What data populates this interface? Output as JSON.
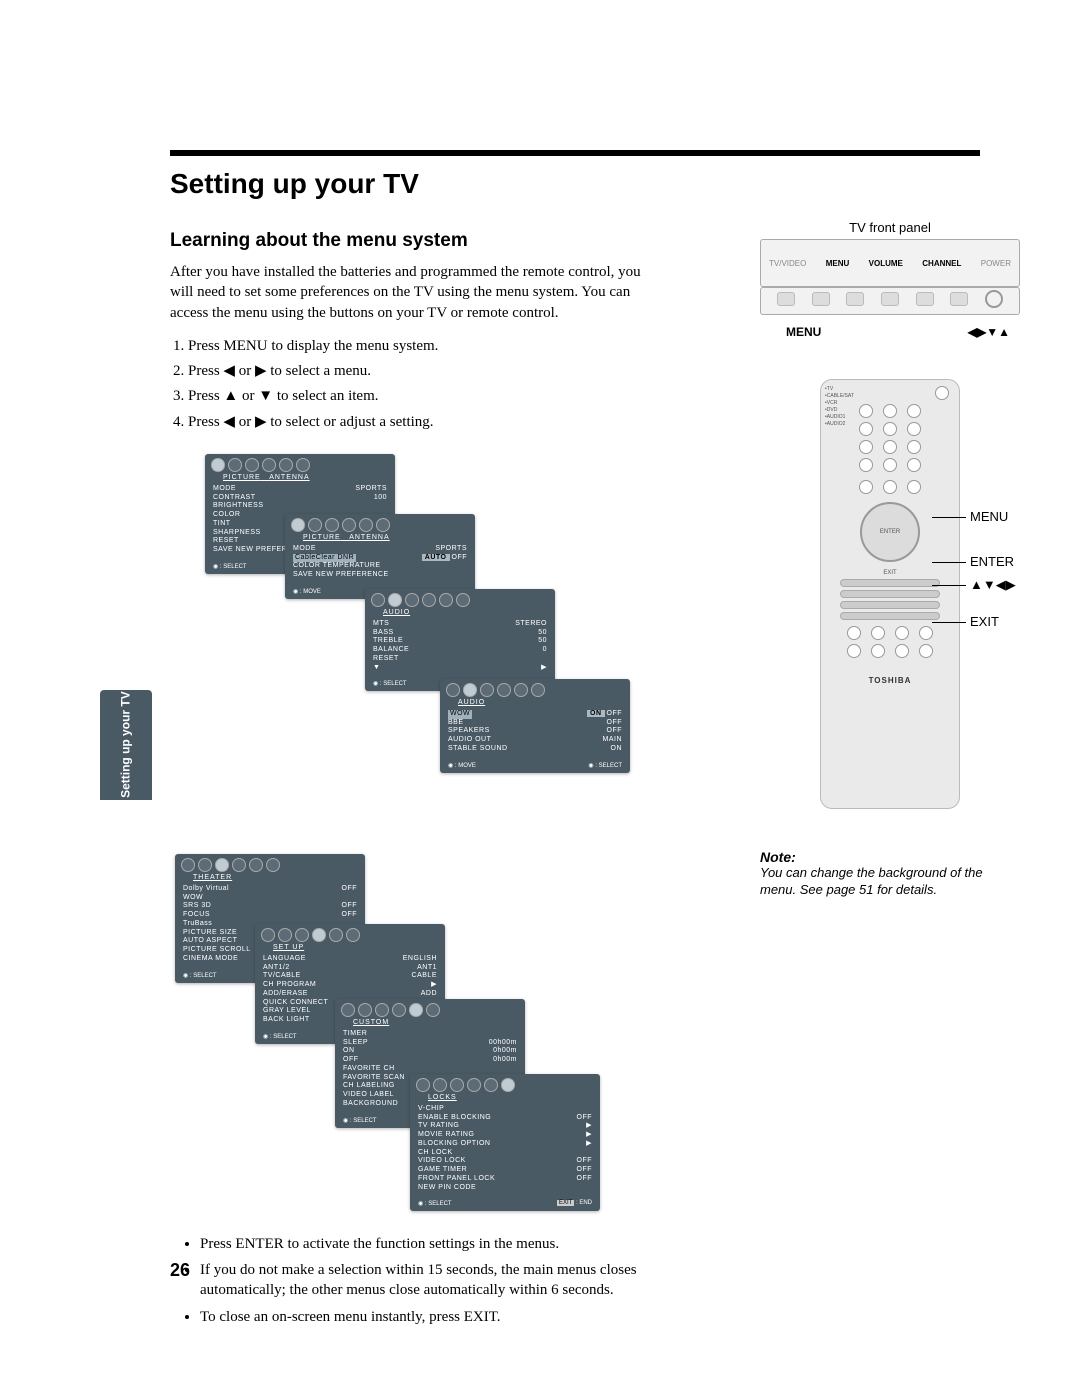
{
  "title": "Setting up your TV",
  "subtitle": "Learning about the menu system",
  "intro": "After you have installed the batteries and programmed the remote control, you will need to set some preferences on the TV using the menu system. You can access the menu using the buttons on your TV or remote control.",
  "steps": [
    "Press MENU to display the menu system.",
    "Press ◀ or ▶ to select a menu.",
    "Press ▲ or ▼ to select an item.",
    "Press ◀ or ▶ to select or adjust a setting."
  ],
  "bullets": [
    "Press ENTER to activate the function settings in the menus.",
    "If you do not make a selection within 15 seconds, the main menus closes automatically; the other menus close automatically within 6 seconds.",
    "To close an on-screen menu instantly, press EXIT."
  ],
  "front_panel": {
    "caption": "TV front panel",
    "labels": [
      "TV/VIDEO",
      "MENU",
      "VOLUME",
      "CHANNEL",
      "POWER"
    ],
    "legend_left": "MENU",
    "legend_right": "◀▶▼▲"
  },
  "remote_callouts": {
    "menu": "MENU",
    "enter": "ENTER",
    "arrows": "▲▼◀▶",
    "exit": "EXIT"
  },
  "remote_brand": "TOSHIBA",
  "remote_side_labels": [
    "TV",
    "CABLE/SAT",
    "VCR",
    "DVD",
    "AUDIO1",
    "AUDIO2"
  ],
  "note": {
    "heading": "Note:",
    "body": "You can change the background of the menu. See page 51 for details."
  },
  "menus": {
    "picture1": {
      "title": "PICTURE",
      "right_tab": "ANTENNA",
      "mode_row": {
        "k": "MODE",
        "v": "SPORTS"
      },
      "items": [
        "CONTRAST",
        "BRIGHTNESS",
        "COLOR",
        "TINT",
        "SHARPNESS",
        "RESET",
        "SAVE NEW PREFERENCE"
      ],
      "value": "100",
      "footer_left": "◉ : SELECT"
    },
    "picture2": {
      "title": "PICTURE",
      "right_tab": "ANTENNA",
      "mode_row": {
        "k": "MODE",
        "v": "SPORTS"
      },
      "highlight": {
        "k": "CableClear DNR",
        "v": "AUTO",
        "off": "OFF"
      },
      "items": [
        "COLOR TEMPERATURE",
        "SAVE NEW PREFERENCE"
      ],
      "footer_left": "◉ : MOVE"
    },
    "audio1": {
      "title": "AUDIO",
      "rows": [
        {
          "k": "MTS",
          "v": "STEREO"
        },
        {
          "k": "BASS",
          "v": "50"
        },
        {
          "k": "TREBLE",
          "v": "50"
        },
        {
          "k": "BALANCE",
          "v": "0"
        },
        {
          "k": "RESET",
          "v": ""
        },
        {
          "k": "▼",
          "v": "▶"
        }
      ],
      "footer_left": "◉ : SELECT"
    },
    "audio2": {
      "title": "AUDIO",
      "highlight": {
        "k": "WOW",
        "on": "ON",
        "off": "OFF"
      },
      "rows": [
        {
          "k": "BBE",
          "v": "OFF"
        },
        {
          "k": "SPEAKERS",
          "v": "OFF"
        },
        {
          "k": "AUDIO OUT",
          "v": "MAIN"
        },
        {
          "k": "STABLE SOUND",
          "v": "ON"
        }
      ],
      "footer_left": "◉ : MOVE",
      "footer_right": "◉ : SELECT"
    },
    "theater": {
      "title": "THEATER",
      "rows": [
        {
          "k": "Dolby Virtual",
          "v": "OFF"
        },
        {
          "k": "WOW",
          "v": ""
        },
        {
          "k": "  SRS 3D",
          "v": "OFF"
        },
        {
          "k": "  FOCUS",
          "v": "OFF"
        },
        {
          "k": "  TruBass",
          "v": ""
        },
        {
          "k": "PICTURE SIZE",
          "v": ""
        },
        {
          "k": "AUTO ASPECT",
          "v": ""
        },
        {
          "k": "PICTURE SCROLL",
          "v": ""
        },
        {
          "k": "CINEMA MODE",
          "v": ""
        }
      ],
      "footer_left": "◉ : SELECT"
    },
    "setup": {
      "title": "SET UP",
      "rows": [
        {
          "k": "LANGUAGE",
          "v": "ENGLISH"
        },
        {
          "k": "ANT1/2",
          "v": "ANT1"
        },
        {
          "k": "TV/CABLE",
          "v": "CABLE"
        },
        {
          "k": "CH PROGRAM",
          "v": "▶"
        },
        {
          "k": "ADD/ERASE",
          "v": "ADD"
        },
        {
          "k": "QUICK CONNECT",
          "v": ""
        },
        {
          "k": "GRAY LEVEL",
          "v": ""
        },
        {
          "k": "BACK LIGHT",
          "v": ""
        }
      ],
      "footer_left": "◉ : SELECT"
    },
    "custom": {
      "title": "CUSTOM",
      "rows": [
        {
          "k": "TIMER",
          "v": ""
        },
        {
          "k": "  SLEEP",
          "v": "00h00m"
        },
        {
          "k": "  ON",
          "v": "0h00m"
        },
        {
          "k": "  OFF",
          "v": "0h00m"
        },
        {
          "k": "FAVORITE CH",
          "v": ""
        },
        {
          "k": "FAVORITE SCAN",
          "v": ""
        },
        {
          "k": "CH LABELING",
          "v": ""
        },
        {
          "k": "VIDEO LABEL",
          "v": ""
        },
        {
          "k": "BACKGROUND",
          "v": ""
        }
      ],
      "footer_left": "◉ : SELECT"
    },
    "locks": {
      "title": "LOCKS",
      "rows": [
        {
          "k": "V-CHIP",
          "v": ""
        },
        {
          "k": "  ENABLE BLOCKING",
          "v": "OFF"
        },
        {
          "k": "  TV RATING",
          "v": "▶"
        },
        {
          "k": "  MOVIE RATING",
          "v": "▶"
        },
        {
          "k": "  BLOCKING OPTION",
          "v": "▶"
        },
        {
          "k": "CH LOCK",
          "v": ""
        },
        {
          "k": "VIDEO LOCK",
          "v": "OFF"
        },
        {
          "k": "GAME TIMER",
          "v": "OFF"
        },
        {
          "k": "FRONT PANEL LOCK",
          "v": "OFF"
        },
        {
          "k": "NEW PIN CODE",
          "v": ""
        }
      ],
      "footer_left": "◉ : SELECT",
      "footer_right": "EXIT : END"
    }
  },
  "side_tab": "Setting up\nyour TV",
  "page_num": "26"
}
